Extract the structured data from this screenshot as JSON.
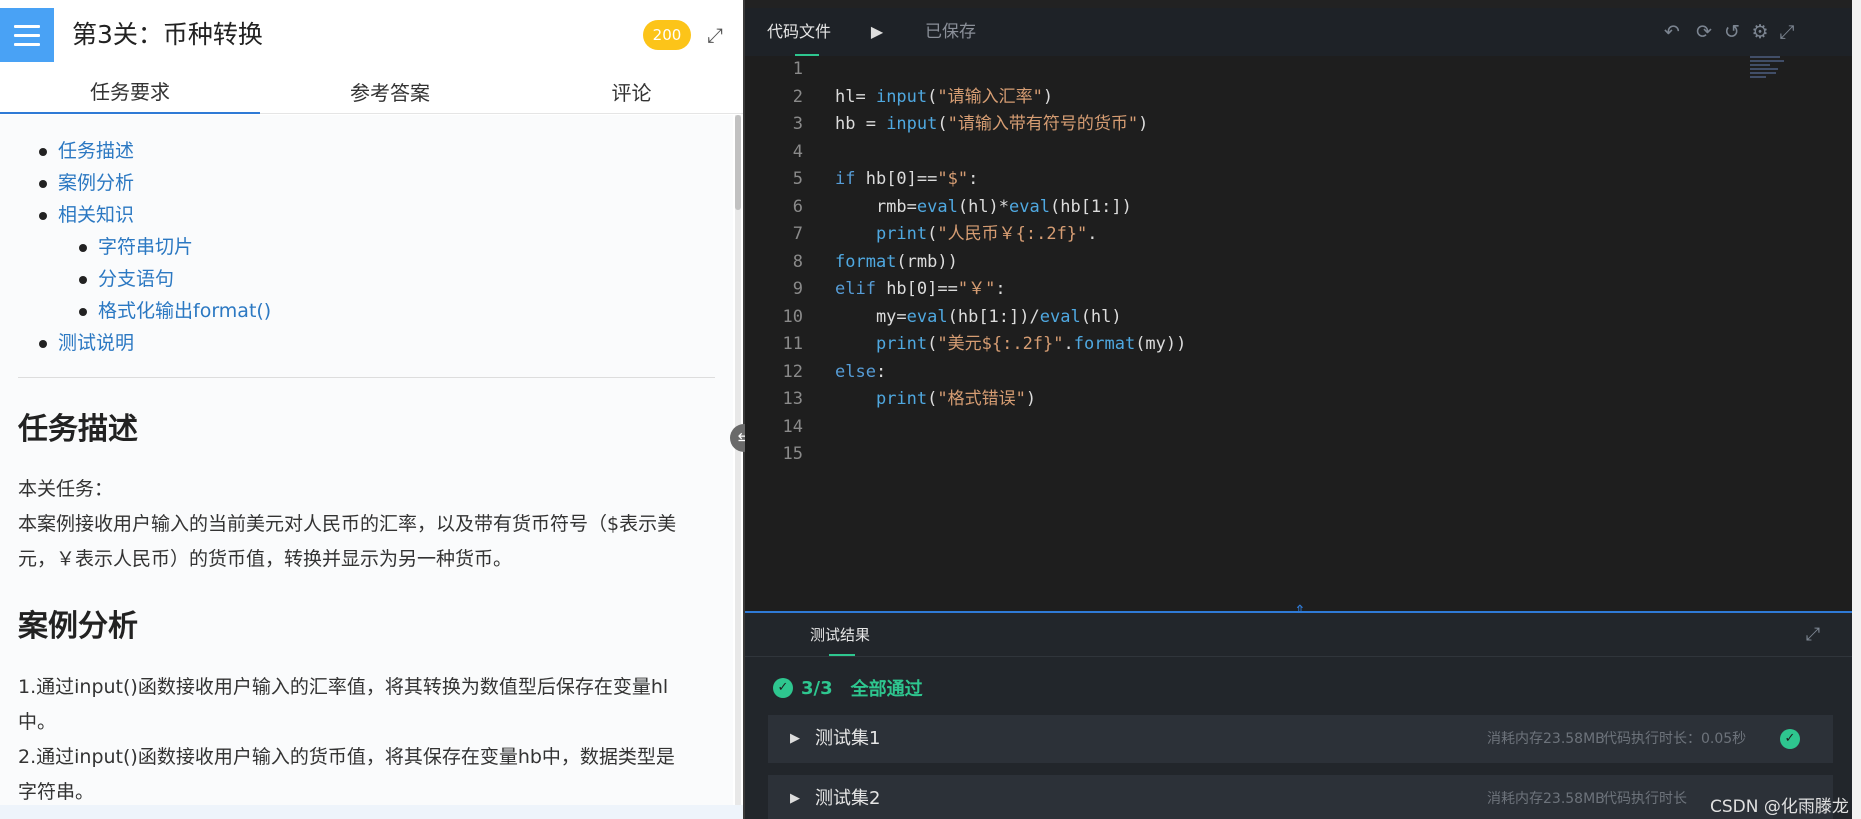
{
  "header": {
    "title": "第3关：币种转换",
    "score": "200",
    "menu_icon": "hamburger-menu-icon",
    "expand_icon": "expand-icon"
  },
  "left_tabs": [
    "任务要求",
    "参考答案",
    "评论"
  ],
  "toc": [
    {
      "label": "任务描述",
      "level": 1
    },
    {
      "label": "案例分析",
      "level": 1
    },
    {
      "label": "相关知识",
      "level": 1
    },
    {
      "label": "字符串切片",
      "level": 2
    },
    {
      "label": "分支语句",
      "level": 2
    },
    {
      "label": "格式化输出format()",
      "level": 2
    },
    {
      "label": "测试说明",
      "level": 1
    }
  ],
  "content": {
    "section1_title": "任务描述",
    "section1_lines": [
      "本关任务：",
      "本案例接收用户输入的当前美元对人民币的汇率，以及带有货币符号（$表示美",
      "元，￥表示人民币）的货币值，转换并显示为另一种货币。"
    ],
    "section2_title": "案例分析",
    "section2_lines": [
      "1.通过input()函数接收用户输入的汇率值，将其转换为数值型后保存在变量hl",
      "中。",
      "2.通过input()函数接收用户输入的货币值，将其保存在变量hb中，数据类型是",
      "字符串。"
    ]
  },
  "editor": {
    "file_tab": "代码文件",
    "saved_status": "已保存",
    "line_numbers": [
      "1",
      "2",
      "3",
      "4",
      "5",
      "6",
      "7",
      "8",
      "9",
      "10",
      "11",
      "12",
      "13",
      "14",
      "15"
    ],
    "toolbar_icons": [
      "undo-icon",
      "refresh-icon",
      "history-icon",
      "settings-icon",
      "fullscreen-icon"
    ]
  },
  "results": {
    "tab_label": "测试结果",
    "pass_count": "3/3",
    "pass_text": "全部通过",
    "test_sets": [
      {
        "name": "测试集1",
        "memory": "消耗内存23.58MB",
        "time": "代码执行时长：0.05秒"
      },
      {
        "name": "测试集2",
        "memory": "消耗内存23.58MB",
        "time": "代码执行时长"
      }
    ]
  },
  "watermark": "CSDN @化雨滕龙",
  "colors": {
    "accent_blue": "#49a2f5",
    "badge_yellow": "#fcc419",
    "pass_green": "#2ec68f",
    "link_blue": "#2b78c2"
  }
}
